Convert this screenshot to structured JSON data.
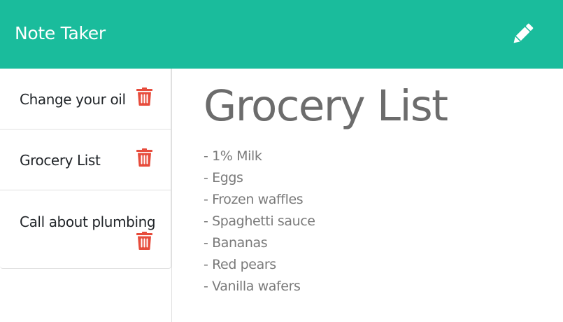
{
  "app": {
    "title": "Note Taker",
    "header_bg": "#1abc9c",
    "new_note_icon": "pencil-icon"
  },
  "sidebar": {
    "notes": [
      {
        "title": "Change your oil",
        "delete_icon": "trash-icon"
      },
      {
        "title": "Grocery List",
        "delete_icon": "trash-icon"
      },
      {
        "title": "Call about plumbing",
        "delete_icon": "trash-icon"
      }
    ],
    "delete_color": "#e74c3c"
  },
  "active_note": {
    "title": "Grocery List",
    "lines": [
      "- 1% Milk",
      "- Eggs",
      "- Frozen waffles",
      "- Spaghetti sauce",
      "- Bananas",
      "- Red pears",
      "- Vanilla wafers"
    ]
  }
}
